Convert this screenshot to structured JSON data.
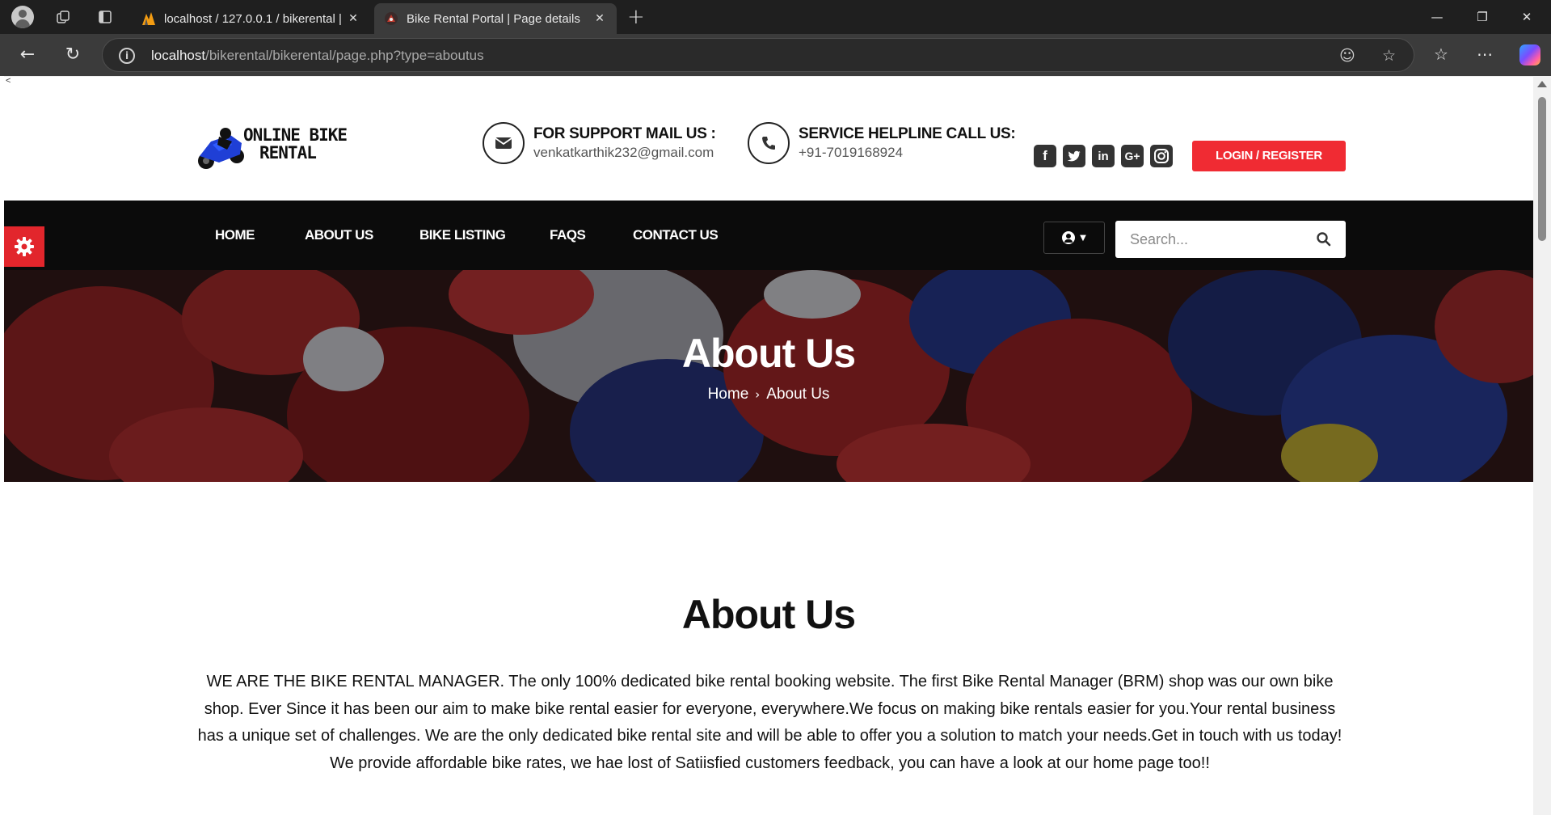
{
  "browser": {
    "tabs": [
      {
        "title": "localhost / 127.0.0.1 / bikerental |",
        "active": false
      },
      {
        "title": "Bike Rental Portal | Page details",
        "active": true
      }
    ],
    "url_host": "localhost",
    "url_path": "/bikerental/bikerental/page.php?type=aboutus"
  },
  "page": {
    "stray_char": "<",
    "logo": {
      "line1": "ONLINE BIKE",
      "line2": "RENTAL"
    },
    "support": {
      "label": "FOR SUPPORT MAIL US :",
      "value": "venkatkarthik232@gmail.com"
    },
    "helpline": {
      "label": "SERVICE HELPLINE CALL US:",
      "value": "+91-7019168924"
    },
    "social": [
      "facebook",
      "twitter",
      "linkedin",
      "google-plus",
      "instagram"
    ],
    "login_label": "LOGIN / REGISTER",
    "nav": [
      "HOME",
      "ABOUT US",
      "BIKE LISTING",
      "FAQS",
      "CONTACT US"
    ],
    "search_placeholder": "Search...",
    "hero": {
      "title": "About Us",
      "crumb_home": "Home",
      "crumb_current": "About Us"
    },
    "about": {
      "title": "About Us",
      "text": "WE ARE THE BIKE RENTAL MANAGER. The only 100% dedicated bike rental booking website. The first Bike Rental Manager (BRM) shop was our own bike shop. Ever Since it has been our aim to make bike rental easier for everyone, everywhere.We focus on making bike rentals easier for you.Your rental business has a unique set of challenges. We are the only dedicated bike rental site and will be able to offer you a solution to match your needs.Get in touch with us today! We provide affordable bike rates, we hae lost of Satiisfied customers feedback, you can have a look at our home page too!!"
    },
    "colors": {
      "accent": "#f02b33",
      "nav_bg": "#0b0b0b",
      "gear_bg": "#e2262c"
    }
  }
}
